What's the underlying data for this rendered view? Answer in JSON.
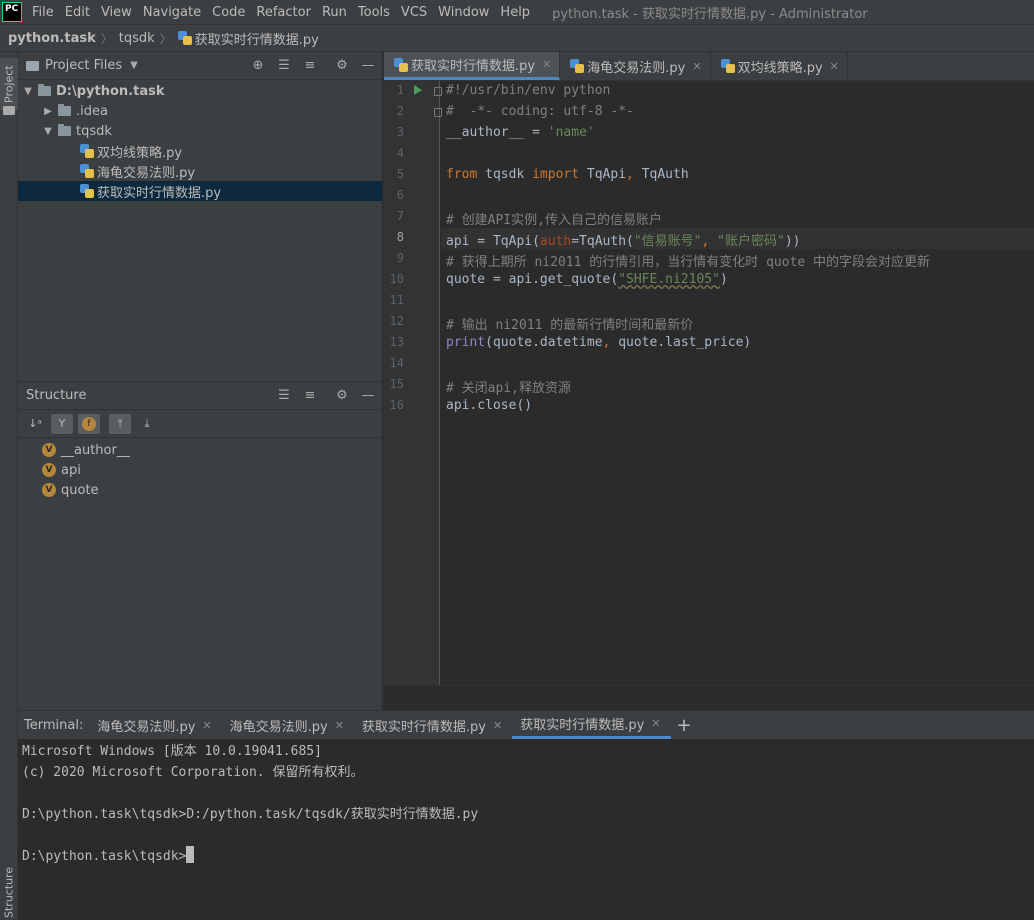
{
  "app": {
    "logo": "PC",
    "menu": [
      "File",
      "Edit",
      "View",
      "Navigate",
      "Code",
      "Refactor",
      "Run",
      "Tools",
      "VCS",
      "Window",
      "Help"
    ],
    "window_title": "python.task - 获取实时行情数据.py - Administrator"
  },
  "breadcrumb": [
    "python.task",
    "tqsdk",
    "获取实时行情数据.py"
  ],
  "sidebar_tabs": {
    "project": "Project",
    "structure": "Structure"
  },
  "project_panel": {
    "title": "Project Files",
    "tree": [
      {
        "label": "D:\\python.task",
        "type": "folder",
        "expanded": true,
        "bold": true
      },
      {
        "label": ".idea",
        "type": "folder",
        "expanded": false
      },
      {
        "label": "tqsdk",
        "type": "folder",
        "expanded": true
      },
      {
        "label": "双均线策略.py",
        "type": "python"
      },
      {
        "label": "海龟交易法则.py",
        "type": "python"
      },
      {
        "label": "获取实时行情数据.py",
        "type": "python",
        "selected": true
      }
    ]
  },
  "structure_panel": {
    "title": "Structure",
    "items": [
      "__author__",
      "api",
      "quote"
    ],
    "badge": "V"
  },
  "editor": {
    "tabs": [
      "获取实时行情数据.py",
      "海龟交易法则.py",
      "双均线策略.py"
    ],
    "active_tab": 0,
    "current_line": 8,
    "line_numbers": [
      "1",
      "2",
      "3",
      "4",
      "5",
      "6",
      "7",
      "8",
      "9",
      "10",
      "11",
      "12",
      "13",
      "14",
      "15",
      "16"
    ]
  },
  "terminal": {
    "label": "Terminal:",
    "tabs": [
      "海龟交易法则.py",
      "海龟交易法则.py",
      "获取实时行情数据.py",
      "获取实时行情数据.py"
    ],
    "active_tab": 3,
    "add_label": "+",
    "lines": [
      "Microsoft Windows [版本 10.0.19041.685]",
      "(c) 2020 Microsoft Corporation. 保留所有权利。",
      "",
      "D:\\python.task\\tqsdk>D:/python.task/tqsdk/获取实时行情数据.py",
      "",
      "D:\\python.task\\tqsdk>"
    ]
  },
  "code": {
    "l1": "#!/usr/bin/env python",
    "l2": "#  -*- coding: utf-8 -*-",
    "l3_var": "__author__",
    "l3_eq": " = ",
    "l3_str": "'name'",
    "l5_from": "from",
    "l5_mod": " tqsdk ",
    "l5_import": "import",
    "l5_names": " TqApi",
    "l5_comma": ",",
    "l5_name2": " TqAuth",
    "l7": "# 创建API实例,传入自己的信易账户",
    "l8_a": "api = TqApi(",
    "l8_param": "auth",
    "l8_b": "=TqAuth(",
    "l8_s1": "\"信易账号\"",
    "l8_comma": ", ",
    "l8_s2": "\"账户密码\"",
    "l8_c": "))",
    "l9": "# 获得上期所 ni2011 的行情引用，当行情有变化时 quote 中的字段会对应更新",
    "l10_a": "quote = api.get_quote(",
    "l10_s": "\"SHFE.ni2105\"",
    "l10_b": ")",
    "l12": "# 输出 ni2011 的最新行情时间和最新价",
    "l13_fn": "print",
    "l13_a": "(quote.datetime",
    "l13_comma": ",",
    "l13_b": " quote.last_price)",
    "l15": "# 关闭api,释放资源",
    "l16": "api.close()"
  }
}
